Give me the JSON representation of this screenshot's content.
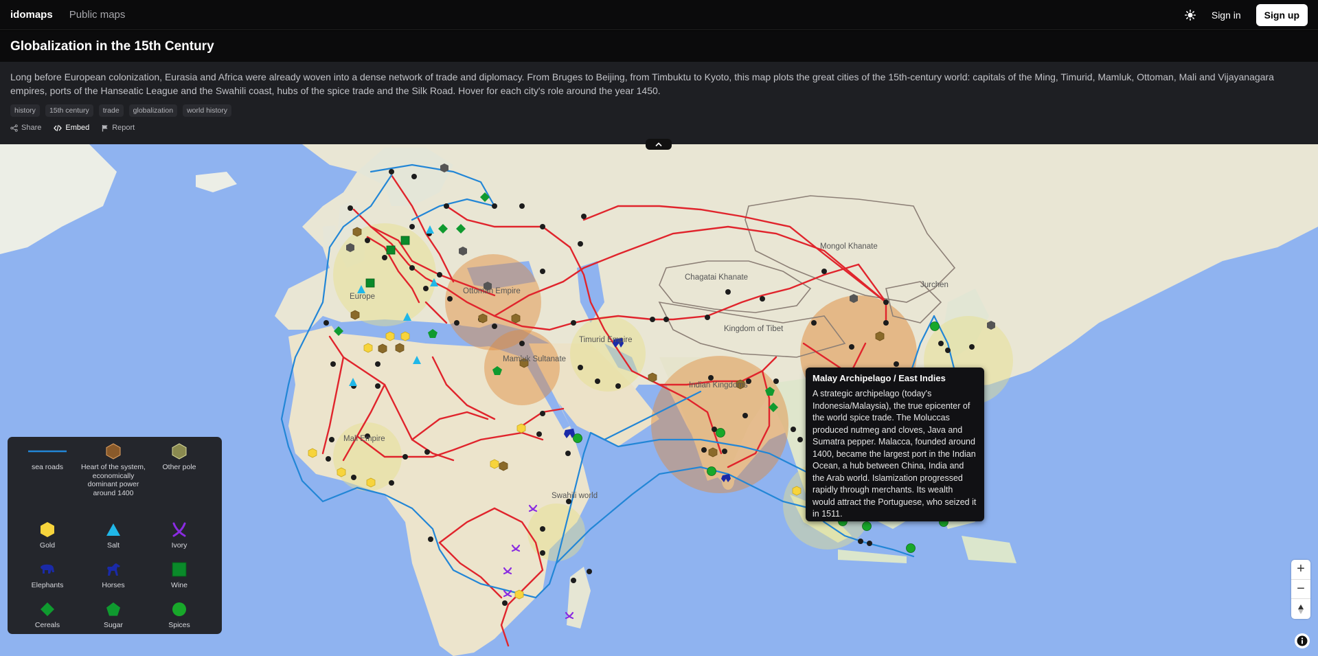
{
  "header": {
    "brand": "idomaps",
    "nav_public": "Public maps",
    "sign_in": "Sign in",
    "sign_up": "Sign up",
    "theme_icon": "sun-icon"
  },
  "page": {
    "title": "Globalization in the 15th Century",
    "description": "Long before European colonization, Eurasia and Africa were already woven into a dense network of trade and diplomacy. From Bruges to Beijing, from Timbuktu to Kyoto, this map plots the great cities of the 15th-century world: capitals of the Ming, Timurid, Mamluk, Ottoman, Mali and Vijayanagara empires, ports of the Hanseatic League and the Swahili coast, hubs of the spice trade and the Silk Road. Hover for each city's role around the year 1450.",
    "tags": [
      "history",
      "15th century",
      "trade",
      "globalization",
      "world history"
    ],
    "actions": {
      "share": "Share",
      "embed": "Embed",
      "report": "Report"
    }
  },
  "map": {
    "labels": {
      "mongol": "Mongol Khanate",
      "chagatai": "Chagatai Khanate",
      "jurchen": "Jurchen",
      "ottoman": "Ottoman Empire",
      "europe": "Europe",
      "tibet": "Kingdom of Tibet",
      "timurid": "Timurid Empire",
      "mamluk": "Mamluk Sultanate",
      "indian": "Indian Kingdoms",
      "mali": "Mali Empire",
      "swahili": "Swahili world"
    },
    "colors": {
      "land_route": "#e0242c",
      "sea_road": "#2286d6",
      "heart": "#e08a3a",
      "other_pole": "#e6df8a",
      "gold": "#f7d43c",
      "salt": "#20b7e8",
      "ivory": "#8a2be2",
      "elephants": "#1a2aa8",
      "wine": "#0a8a2a",
      "cereals": "#0f9a2f",
      "spices": "#18a82a"
    }
  },
  "tooltip": {
    "title": "Malay Archipelago / East Indies",
    "body": "A strategic archipelago (today's Indonesia/Malaysia), the true epicenter of the world spice trade. The Moluccas produced nutmeg and cloves, Java and Sumatra pepper. Malacca, founded around 1400, became the largest port in the Indian Ocean, a hub between China, India and the Arab world. Islamization progressed rapidly through merchants. Its wealth would attract the Portuguese, who seized it in 1511."
  },
  "legend": {
    "items": [
      {
        "label": "sea roads",
        "icon": "sea-road-line"
      },
      {
        "label": "Heart of the system, economically dominant power around 1400",
        "icon": "brown-hexagon"
      },
      {
        "label": "Other pole",
        "icon": "olive-hexagon"
      },
      {
        "label": "Gold",
        "icon": "gold-hexagon"
      },
      {
        "label": "Salt",
        "icon": "salt-triangle"
      },
      {
        "label": "Ivory",
        "icon": "ivory-tusks-icon"
      },
      {
        "label": "Elephants",
        "icon": "elephant-icon"
      },
      {
        "label": "Horses",
        "icon": "horse-icon"
      },
      {
        "label": "Wine",
        "icon": "wine-square"
      },
      {
        "label": "Cereals",
        "icon": "cereals-diamond"
      },
      {
        "label": "Sugar",
        "icon": "sugar-pentagon"
      },
      {
        "label": "Spices",
        "icon": "spices-circle"
      }
    ]
  },
  "controls": {
    "zoom_in": "+",
    "zoom_out": "−"
  }
}
